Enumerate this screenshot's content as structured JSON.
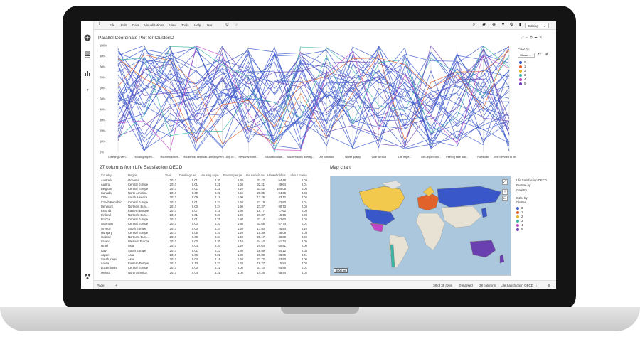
{
  "menu": {
    "items": [
      "File",
      "Edit",
      "Data",
      "Visualizations",
      "View",
      "Tools",
      "Help",
      "User"
    ],
    "editing_label": "Editing"
  },
  "parallel": {
    "title": "Parallel Coordinate Plot for ClusterID",
    "y_ticks": [
      "100%",
      "90%",
      "80%",
      "70%",
      "60%",
      "50%",
      "40%",
      "30%",
      "20%",
      "10%",
      "0%"
    ],
    "axes": [
      "Dwellings with...",
      "Housing expen...",
      "Household net...",
      "Household net finan...",
      "Employment Long-te...",
      "Personal earni...",
      "Educational att...",
      "Student skills averag...",
      "Air pollution",
      "Water quality",
      "Vote turnout",
      "Life expe...",
      "Self-reported h...",
      "Feeling safe wal...",
      "Homicide",
      "Time devoted to leisure a..."
    ],
    "color_by_label": "Color by:",
    "color_by_value": "Cluster...",
    "legend": [
      "0",
      "1",
      "2",
      "3",
      "4",
      "5"
    ],
    "legend_colors": [
      "#3a57c9",
      "#e2622b",
      "#e6b72e",
      "#3bb5a6",
      "#c243c4",
      "#6a3fb0"
    ]
  },
  "table": {
    "title": "27 columns from Life Satisfaction OECD",
    "headers": [
      "Country",
      "Region",
      "Year",
      "Dwellings wit...",
      "Housing expe...",
      "Rooms per pe...",
      "Household ne...",
      "Household ne...",
      "Labour marke..."
    ],
    "rows": [
      [
        "Australia",
        "Oceania",
        "2017",
        "0.01",
        "0.20",
        "2.30",
        "33.42",
        "54.48",
        "0.03"
      ],
      [
        "Austria",
        "Central Europe",
        "2017",
        "0.01",
        "0.21",
        "1.60",
        "32.21",
        "29.64",
        "0.01"
      ],
      [
        "Belgium",
        "Central Europe",
        "2017",
        "0.01",
        "0.21",
        "2.20",
        "31.42",
        "104.08",
        "0.05"
      ],
      [
        "Canada",
        "North America",
        "2017",
        "0.00",
        "0.22",
        "2.50",
        "29.85",
        "84.65",
        "0.04"
      ],
      [
        "Chile",
        "South America",
        "2017",
        "0.09",
        "0.18",
        "1.90",
        "17.25",
        "33.12",
        "0.06"
      ],
      [
        "Czech Republic",
        "Central Europe",
        "2017",
        "0.01",
        "0.24",
        "1.40",
        "21.19",
        "22.90",
        "0.01"
      ],
      [
        "Denmark",
        "Northern Euro...",
        "2017",
        "0.00",
        "0.24",
        "1.90",
        "27.37",
        "90.73",
        "0.03"
      ],
      [
        "Estonia",
        "Eastern Europe",
        "2017",
        "0.07",
        "0.18",
        "1.60",
        "19.77",
        "17.62",
        "0.03"
      ],
      [
        "Finland",
        "Northern Euro...",
        "2017",
        "0.01",
        "0.23",
        "1.90",
        "29.37",
        "18.68",
        "0.03"
      ],
      [
        "France",
        "Central Europe",
        "2017",
        "0.01",
        "0.21",
        "1.80",
        "31.14",
        "52.63",
        "0.02"
      ],
      [
        "Germany",
        "Central Europe",
        "2017",
        "0.00",
        "0.20",
        "1.80",
        "33.65",
        "57.74",
        "0.01"
      ],
      [
        "Greece",
        "South Europe",
        "2017",
        "0.00",
        "0.24",
        "1.20",
        "17.50",
        "25.84",
        "0.10"
      ],
      [
        "Hungary",
        "Central Europe",
        "2017",
        "0.05",
        "0.20",
        "1.20",
        "16.39",
        "28.09",
        "0.03"
      ],
      [
        "Iceland",
        "Northern Euro...",
        "2017",
        "0.00",
        "0.24",
        "1.60",
        "28.17",
        "36.89",
        "0.00"
      ],
      [
        "Ireland",
        "Western Europe",
        "2017",
        "0.00",
        "0.20",
        "2.10",
        "24.10",
        "51.74",
        "0.05"
      ],
      [
        "Israel",
        "Asia",
        "2017",
        "0.04",
        "0.20",
        "1.20",
        "24.64",
        "60.81",
        "0.00"
      ],
      [
        "Italy",
        "South Europe",
        "2017",
        "0.01",
        "0.23",
        "1.40",
        "26.59",
        "54.12",
        "0.04"
      ],
      [
        "Japan",
        "Asia",
        "2017",
        "0.06",
        "0.22",
        "1.80",
        "29.80",
        "86.90",
        "0.01"
      ],
      [
        "South Korea",
        "Asia",
        "2017",
        "0.04",
        "0.16",
        "1.40",
        "21.72",
        "33.50",
        "0.00"
      ],
      [
        "Latvia",
        "Eastern Europe",
        "2017",
        "0.13",
        "0.23",
        "1.20",
        "16.27",
        "15.84",
        "0.04"
      ],
      [
        "Luxembourg",
        "Central Europe",
        "2017",
        "0.00",
        "0.21",
        "2.00",
        "37.10",
        "84.95",
        "0.01"
      ],
      [
        "Mexico",
        "North America",
        "2017",
        "0.04",
        "0.21",
        "1.00",
        "14.26",
        "55.44",
        "0.02"
      ]
    ]
  },
  "map": {
    "title": "Map chart",
    "legend_title": "Life Satisfaction OECD",
    "feature_by_label": "Feature by:",
    "feature_by_value": "Country",
    "color_by_label": "Color by:",
    "color_by_value": "Cluster...",
    "legend": [
      "0",
      "1",
      "2",
      "3",
      "4",
      "5"
    ],
    "scale_label": "3000 mi"
  },
  "status": {
    "page_tab": "Page",
    "add_tab": "+",
    "rows": "38 of 38 rows",
    "marked": "0 marked",
    "columns": "28 columns",
    "source": "Life Satisfaction OECD"
  }
}
